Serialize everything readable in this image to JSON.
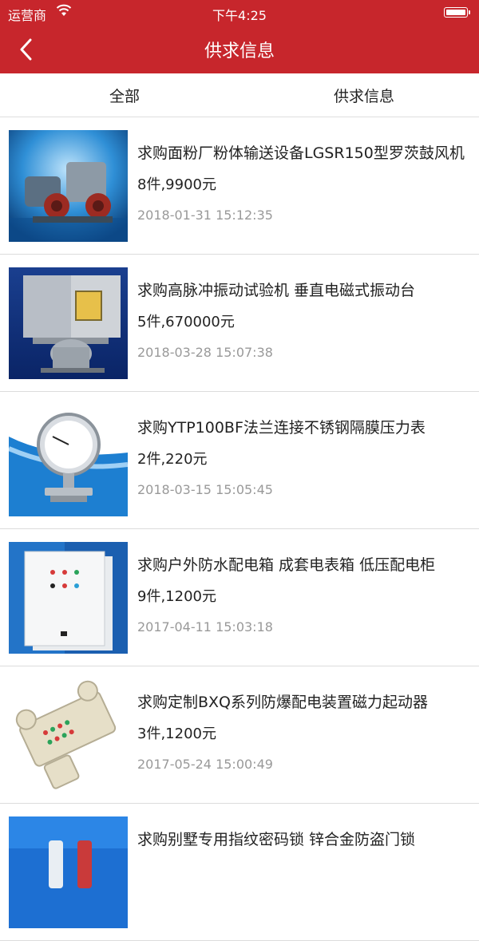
{
  "status": {
    "carrier": "运营商",
    "time": "下午4:25"
  },
  "header": {
    "title": "供求信息"
  },
  "tabs": [
    {
      "label": "全部"
    },
    {
      "label": "供求信息"
    }
  ],
  "items": [
    {
      "title": "求购面粉厂粉体输送设备LGSR150型罗茨鼓风机",
      "price": "8件,9900元",
      "date": "2018-01-31 15:12:35",
      "image": "blower-machine"
    },
    {
      "title": "求购高脉冲振动试验机 垂直电磁式振动台",
      "price": "5件,670000元",
      "date": "2018-03-28 15:07:38",
      "image": "vibration-tester"
    },
    {
      "title": "求购YTP100BF法兰连接不锈钢隔膜压力表",
      "price": "2件,220元",
      "date": "2018-03-15 15:05:45",
      "image": "pressure-gauge"
    },
    {
      "title": "求购户外防水配电箱 成套电表箱 低压配电柜",
      "price": "9件,1200元",
      "date": "2017-04-11 15:03:18",
      "image": "distribution-box"
    },
    {
      "title": "求购定制BXQ系列防爆配电装置磁力起动器",
      "price": "3件,1200元",
      "date": "2017-05-24 15:00:49",
      "image": "explosion-proof-panel"
    },
    {
      "title": "求购别墅专用指纹密码锁 锌合金防盗门锁",
      "price": "",
      "date": "",
      "image": "door-lock"
    }
  ]
}
